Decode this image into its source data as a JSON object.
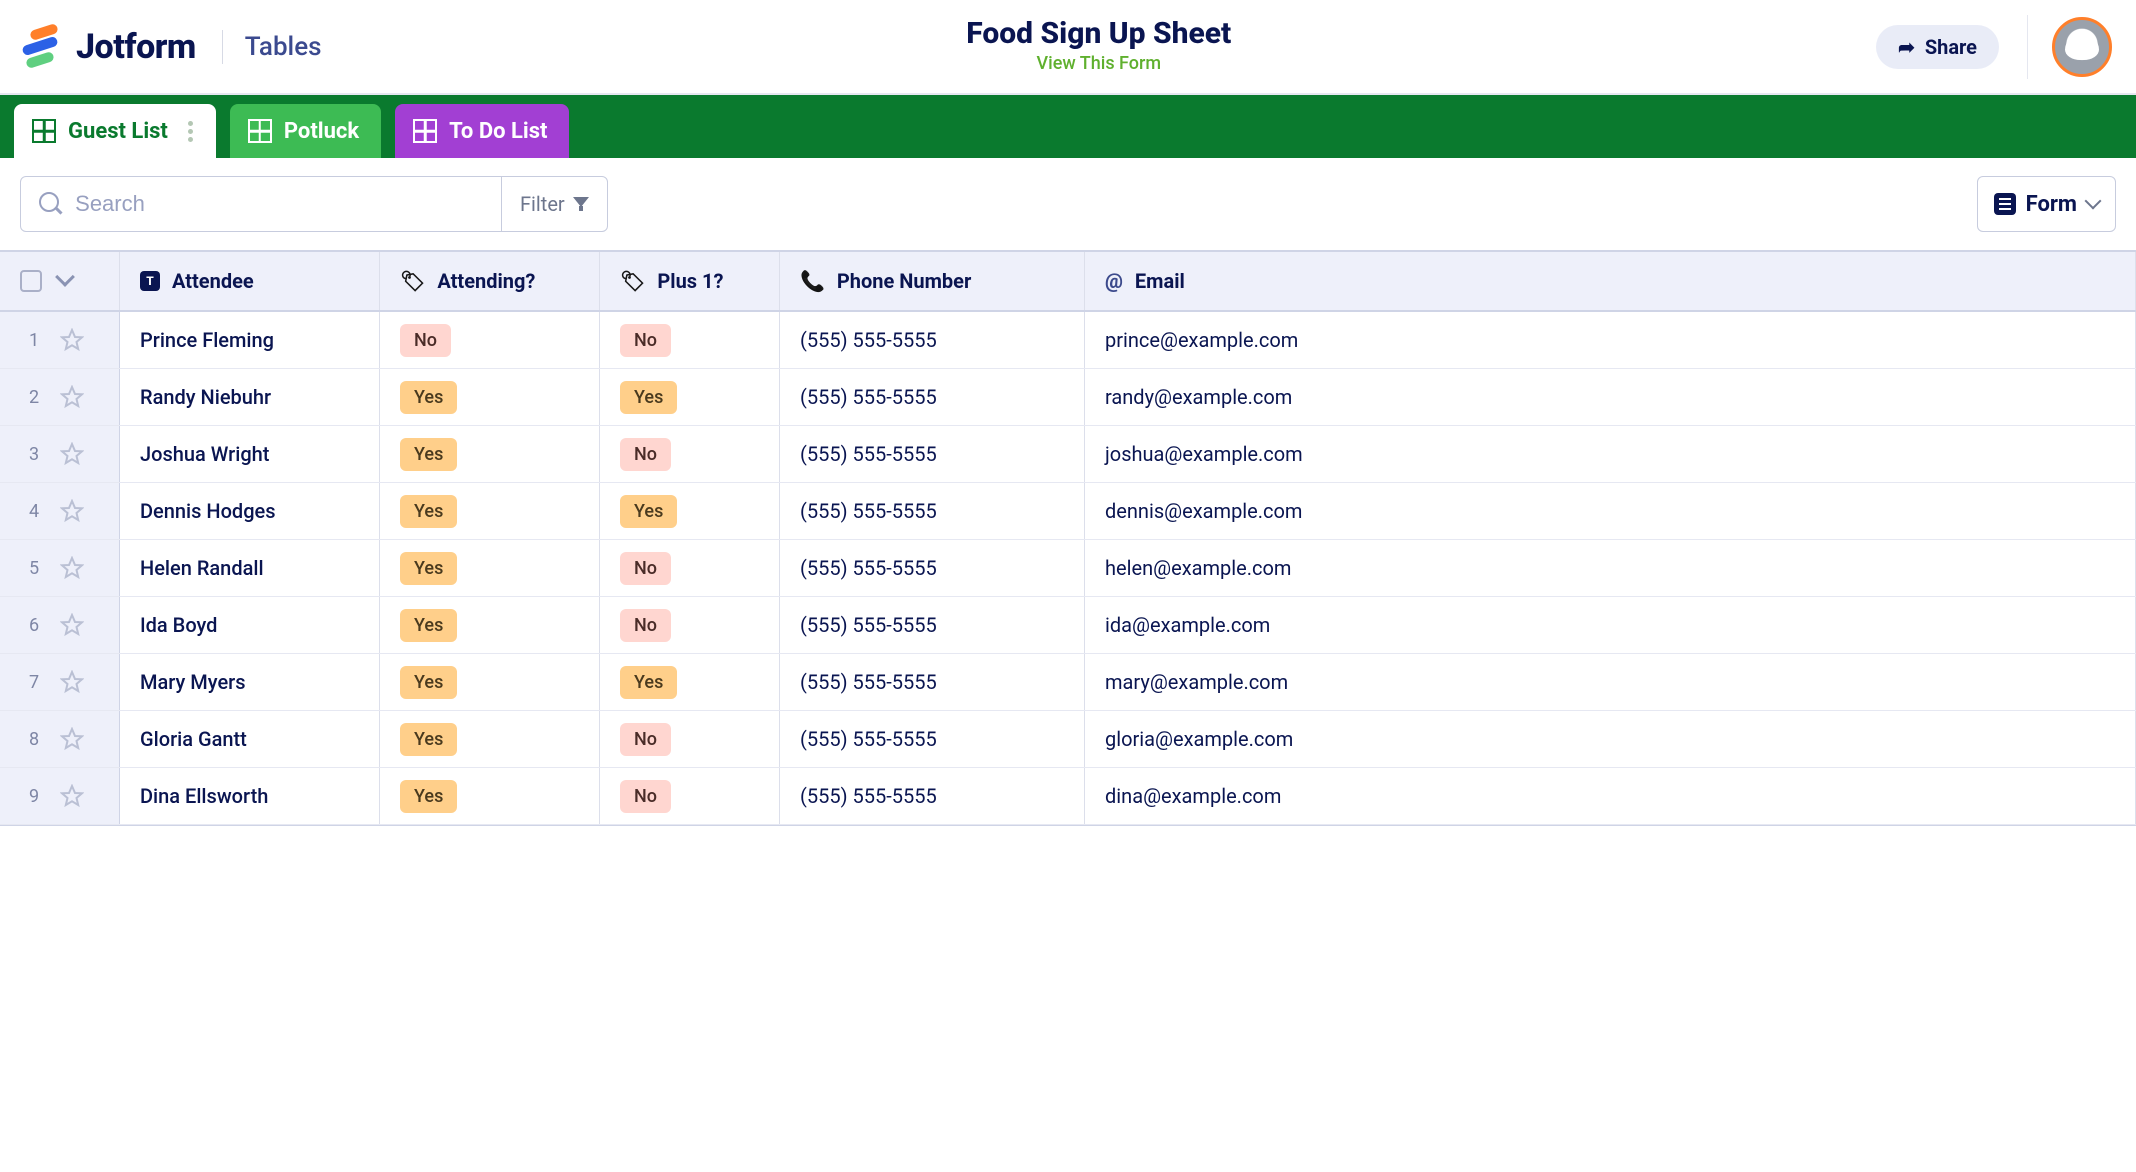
{
  "brand": {
    "name": "Jotform",
    "section": "Tables"
  },
  "header": {
    "title": "Food Sign Up Sheet",
    "view_link": "View This Form",
    "share_label": "Share"
  },
  "tabs": [
    {
      "id": "guest",
      "label": "Guest List"
    },
    {
      "id": "potluck",
      "label": "Potluck"
    },
    {
      "id": "todo",
      "label": "To Do List"
    }
  ],
  "toolbar": {
    "search_placeholder": "Search",
    "filter_label": "Filter",
    "view_label": "Form"
  },
  "columns": {
    "attendee": "Attendee",
    "attending": "Attending?",
    "plus1": "Plus 1?",
    "phone": "Phone Number",
    "email": "Email"
  },
  "rows": [
    {
      "n": "1",
      "attendee": "Prince Fleming",
      "attending": "No",
      "plus1": "No",
      "phone": "(555) 555-5555",
      "email": "prince@example.com"
    },
    {
      "n": "2",
      "attendee": "Randy Niebuhr",
      "attending": "Yes",
      "plus1": "Yes",
      "phone": "(555) 555-5555",
      "email": "randy@example.com"
    },
    {
      "n": "3",
      "attendee": "Joshua Wright",
      "attending": "Yes",
      "plus1": "No",
      "phone": "(555) 555-5555",
      "email": "joshua@example.com"
    },
    {
      "n": "4",
      "attendee": "Dennis Hodges",
      "attending": "Yes",
      "plus1": "Yes",
      "phone": "(555) 555-5555",
      "email": "dennis@example.com"
    },
    {
      "n": "5",
      "attendee": "Helen Randall",
      "attending": "Yes",
      "plus1": "No",
      "phone": "(555) 555-5555",
      "email": "helen@example.com"
    },
    {
      "n": "6",
      "attendee": "Ida Boyd",
      "attending": "Yes",
      "plus1": "No",
      "phone": "(555) 555-5555",
      "email": "ida@example.com"
    },
    {
      "n": "7",
      "attendee": "Mary Myers",
      "attending": "Yes",
      "plus1": "Yes",
      "phone": "(555) 555-5555",
      "email": "mary@example.com"
    },
    {
      "n": "8",
      "attendee": "Gloria Gantt",
      "attending": "Yes",
      "plus1": "No",
      "phone": "(555) 555-5555",
      "email": "gloria@example.com"
    },
    {
      "n": "9",
      "attendee": "Dina Ellsworth",
      "attending": "Yes",
      "plus1": "No",
      "phone": "(555) 555-5555",
      "email": "dina@example.com"
    }
  ]
}
